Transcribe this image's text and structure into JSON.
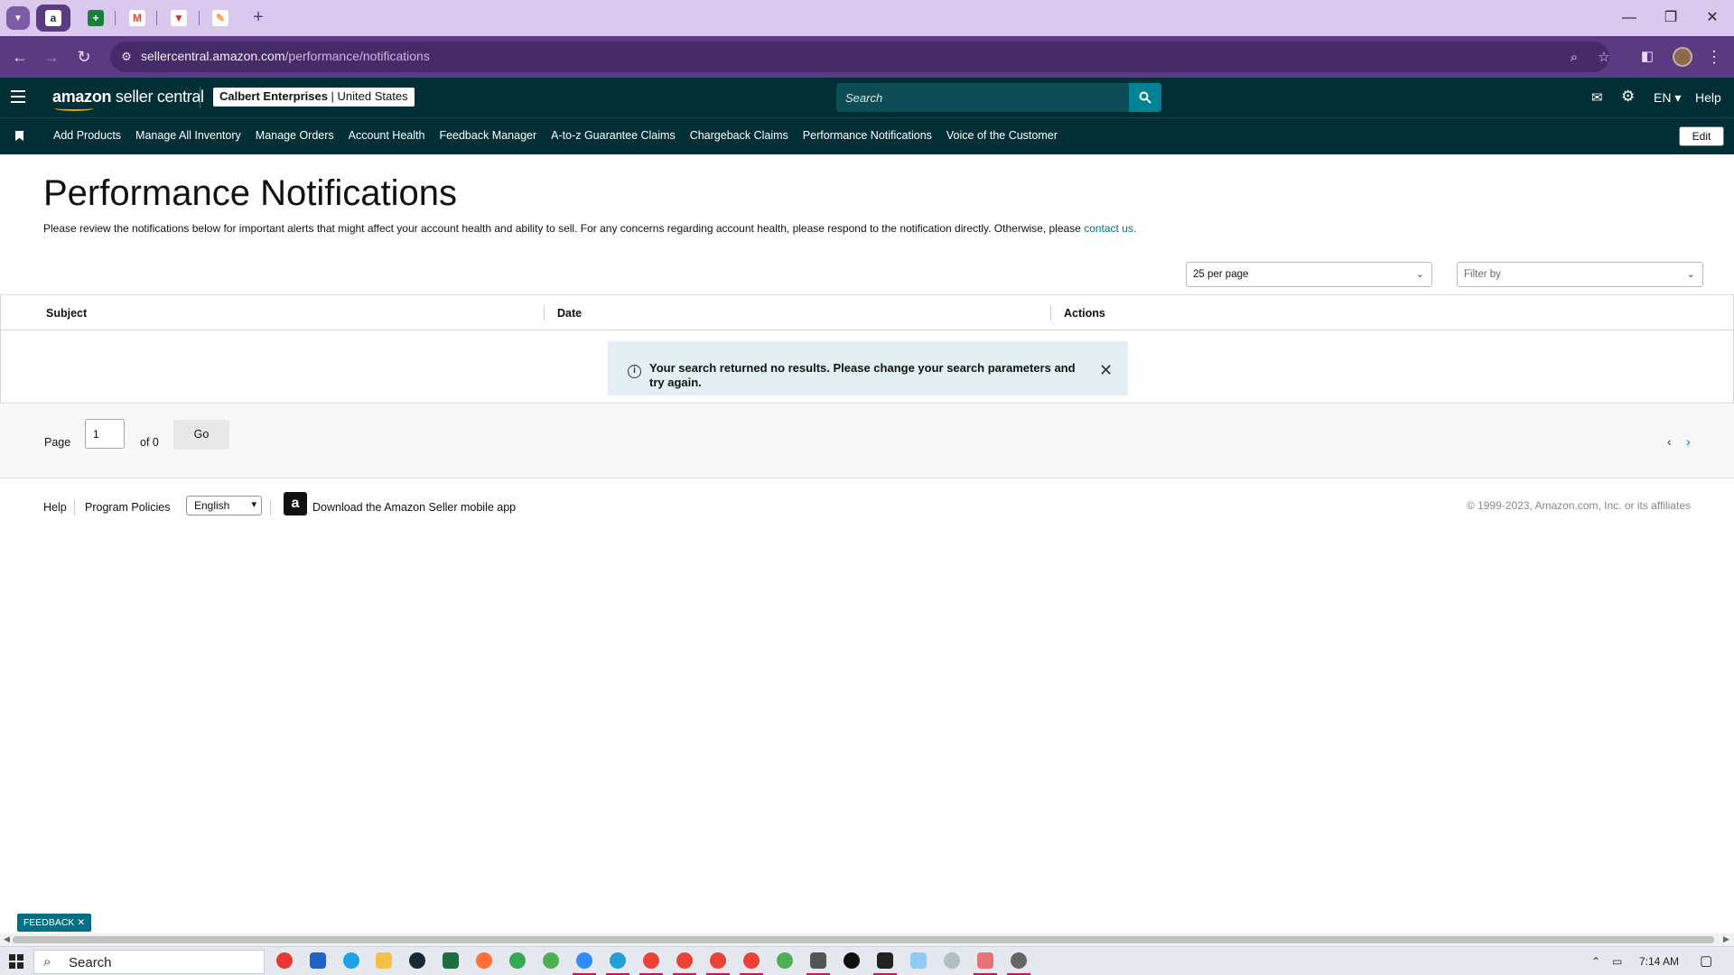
{
  "browser": {
    "url_host": "sellercentral.amazon.com",
    "url_path": "/performance/notifications",
    "tabs": [
      {
        "favicon": "amazon-a",
        "letter": "a",
        "color": "#232f3e"
      },
      {
        "favicon": "sheets",
        "letter": "+",
        "color": "#188038"
      },
      {
        "favicon": "gmail",
        "letter": "M",
        "color": "#ea4335"
      },
      {
        "favicon": "todoist",
        "letter": "▼",
        "color": "#d32f2f"
      },
      {
        "favicon": "pencil-app",
        "letter": "✎",
        "color": "#f2a03d"
      }
    ]
  },
  "header": {
    "logo_bold": "amazon",
    "logo_text": " seller central",
    "account_name": "Calbert Enterprises",
    "account_region": "United States",
    "search_placeholder": "Search",
    "language": "EN",
    "help": "Help"
  },
  "nav": {
    "links": [
      "Add Products",
      "Manage All Inventory",
      "Manage Orders",
      "Account Health",
      "Feedback Manager",
      "A-to-z Guarantee Claims",
      "Chargeback Claims",
      "Performance Notifications",
      "Voice of the Customer"
    ],
    "edit": "Edit"
  },
  "page": {
    "title": "Performance Notifications",
    "description": "Please review the notifications below for important alerts that might affect your account health and ability to sell. For any concerns regarding account health, please respond to the notification directly. Otherwise, please ",
    "contact_link": "contact us.",
    "per_page": "25 per page",
    "filter_placeholder": "Filter by"
  },
  "table": {
    "columns": [
      "Subject",
      "Date",
      "Actions"
    ],
    "empty_message": "Your search returned no results. Please change your search parameters and try again."
  },
  "pagination": {
    "page_label": "Page",
    "current_page": "1",
    "of_label": "of 0",
    "go": "Go"
  },
  "footer": {
    "help": "Help",
    "program_policies": "Program Policies",
    "language": "English",
    "app_download": "Download the Amazon Seller mobile app",
    "copyright": "© 1999-2023, Amazon.com, Inc. or its affiliates",
    "feedback": "FEEDBACK"
  },
  "taskbar": {
    "search_label": "Search",
    "time": "7:14 AM"
  }
}
